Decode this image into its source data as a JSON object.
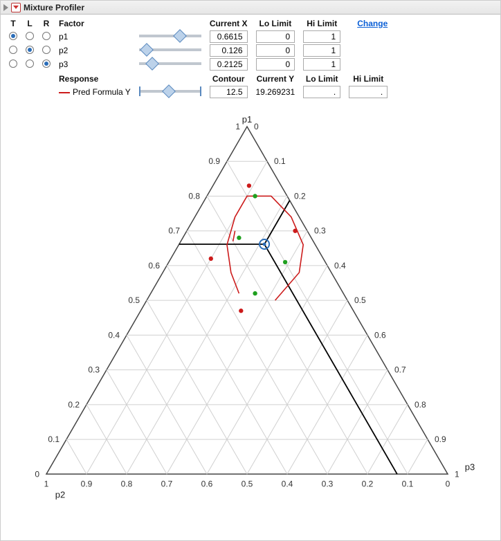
{
  "title": "Mixture Profiler",
  "headers": {
    "T": "T",
    "L": "L",
    "R": "R",
    "factor": "Factor",
    "currentX": "Current X",
    "loLimit": "Lo Limit",
    "hiLimit": "Hi Limit",
    "response": "Response",
    "contour": "Contour",
    "currentY": "Current Y"
  },
  "change_link": "Change",
  "factors": [
    {
      "name": "p1",
      "T": true,
      "L": false,
      "R": false,
      "slider": 0.6615,
      "currentX": "0.6615",
      "lo": "0",
      "hi": "1"
    },
    {
      "name": "p2",
      "T": false,
      "L": true,
      "R": false,
      "slider": 0.126,
      "currentX": "0.126",
      "lo": "0",
      "hi": "1"
    },
    {
      "name": "p3",
      "T": false,
      "L": false,
      "R": true,
      "slider": 0.2125,
      "currentX": "0.2125",
      "lo": "0",
      "hi": "1"
    }
  ],
  "response": {
    "name": "Pred Formula Y",
    "slider": 0.48,
    "contour": "12.5",
    "currentY": "19.269231",
    "lo": ".",
    "hi": "."
  },
  "chart_data": {
    "type": "ternary",
    "vertices": {
      "top": "p1",
      "left": "p2",
      "right": "p3"
    },
    "tick_range": [
      0,
      1
    ],
    "tick_step": 0.1,
    "ticks": [
      "0",
      "0.1",
      "0.2",
      "0.3",
      "0.4",
      "0.5",
      "0.6",
      "0.7",
      "0.8",
      "0.9",
      "1"
    ],
    "current_point": {
      "p1": 0.6615,
      "p2": 0.126,
      "p3": 0.2125
    },
    "contour_level": 12.5,
    "points_red": [
      {
        "p1": 0.83,
        "p2": 0.08,
        "p3": 0.09
      },
      {
        "p1": 0.7,
        "p2": 0.03,
        "p3": 0.27
      },
      {
        "p1": 0.62,
        "p2": 0.28,
        "p3": 0.1
      },
      {
        "p1": 0.47,
        "p2": 0.28,
        "p3": 0.25
      }
    ],
    "points_green": [
      {
        "p1": 0.8,
        "p2": 0.08,
        "p3": 0.12
      },
      {
        "p1": 0.68,
        "p2": 0.18,
        "p3": 0.14
      },
      {
        "p1": 0.61,
        "p2": 0.1,
        "p3": 0.29
      },
      {
        "p1": 0.52,
        "p2": 0.22,
        "p3": 0.26
      }
    ]
  }
}
